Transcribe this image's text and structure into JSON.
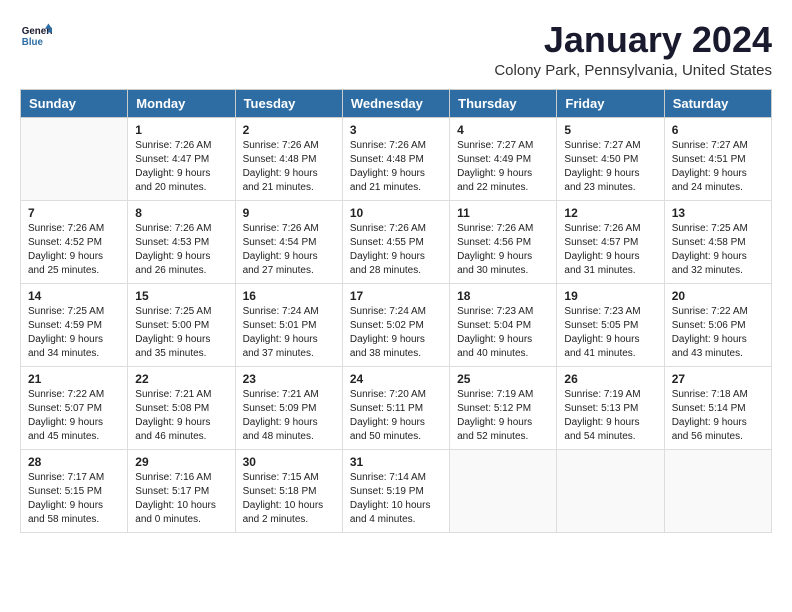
{
  "header": {
    "logo_line1": "General",
    "logo_line2": "Blue",
    "month": "January 2024",
    "location": "Colony Park, Pennsylvania, United States"
  },
  "days_of_week": [
    "Sunday",
    "Monday",
    "Tuesday",
    "Wednesday",
    "Thursday",
    "Friday",
    "Saturday"
  ],
  "weeks": [
    [
      {
        "day": "",
        "info": ""
      },
      {
        "day": "1",
        "info": "Sunrise: 7:26 AM\nSunset: 4:47 PM\nDaylight: 9 hours\nand 20 minutes."
      },
      {
        "day": "2",
        "info": "Sunrise: 7:26 AM\nSunset: 4:48 PM\nDaylight: 9 hours\nand 21 minutes."
      },
      {
        "day": "3",
        "info": "Sunrise: 7:26 AM\nSunset: 4:48 PM\nDaylight: 9 hours\nand 21 minutes."
      },
      {
        "day": "4",
        "info": "Sunrise: 7:27 AM\nSunset: 4:49 PM\nDaylight: 9 hours\nand 22 minutes."
      },
      {
        "day": "5",
        "info": "Sunrise: 7:27 AM\nSunset: 4:50 PM\nDaylight: 9 hours\nand 23 minutes."
      },
      {
        "day": "6",
        "info": "Sunrise: 7:27 AM\nSunset: 4:51 PM\nDaylight: 9 hours\nand 24 minutes."
      }
    ],
    [
      {
        "day": "7",
        "info": "Sunrise: 7:26 AM\nSunset: 4:52 PM\nDaylight: 9 hours\nand 25 minutes."
      },
      {
        "day": "8",
        "info": "Sunrise: 7:26 AM\nSunset: 4:53 PM\nDaylight: 9 hours\nand 26 minutes."
      },
      {
        "day": "9",
        "info": "Sunrise: 7:26 AM\nSunset: 4:54 PM\nDaylight: 9 hours\nand 27 minutes."
      },
      {
        "day": "10",
        "info": "Sunrise: 7:26 AM\nSunset: 4:55 PM\nDaylight: 9 hours\nand 28 minutes."
      },
      {
        "day": "11",
        "info": "Sunrise: 7:26 AM\nSunset: 4:56 PM\nDaylight: 9 hours\nand 30 minutes."
      },
      {
        "day": "12",
        "info": "Sunrise: 7:26 AM\nSunset: 4:57 PM\nDaylight: 9 hours\nand 31 minutes."
      },
      {
        "day": "13",
        "info": "Sunrise: 7:25 AM\nSunset: 4:58 PM\nDaylight: 9 hours\nand 32 minutes."
      }
    ],
    [
      {
        "day": "14",
        "info": "Sunrise: 7:25 AM\nSunset: 4:59 PM\nDaylight: 9 hours\nand 34 minutes."
      },
      {
        "day": "15",
        "info": "Sunrise: 7:25 AM\nSunset: 5:00 PM\nDaylight: 9 hours\nand 35 minutes."
      },
      {
        "day": "16",
        "info": "Sunrise: 7:24 AM\nSunset: 5:01 PM\nDaylight: 9 hours\nand 37 minutes."
      },
      {
        "day": "17",
        "info": "Sunrise: 7:24 AM\nSunset: 5:02 PM\nDaylight: 9 hours\nand 38 minutes."
      },
      {
        "day": "18",
        "info": "Sunrise: 7:23 AM\nSunset: 5:04 PM\nDaylight: 9 hours\nand 40 minutes."
      },
      {
        "day": "19",
        "info": "Sunrise: 7:23 AM\nSunset: 5:05 PM\nDaylight: 9 hours\nand 41 minutes."
      },
      {
        "day": "20",
        "info": "Sunrise: 7:22 AM\nSunset: 5:06 PM\nDaylight: 9 hours\nand 43 minutes."
      }
    ],
    [
      {
        "day": "21",
        "info": "Sunrise: 7:22 AM\nSunset: 5:07 PM\nDaylight: 9 hours\nand 45 minutes."
      },
      {
        "day": "22",
        "info": "Sunrise: 7:21 AM\nSunset: 5:08 PM\nDaylight: 9 hours\nand 46 minutes."
      },
      {
        "day": "23",
        "info": "Sunrise: 7:21 AM\nSunset: 5:09 PM\nDaylight: 9 hours\nand 48 minutes."
      },
      {
        "day": "24",
        "info": "Sunrise: 7:20 AM\nSunset: 5:11 PM\nDaylight: 9 hours\nand 50 minutes."
      },
      {
        "day": "25",
        "info": "Sunrise: 7:19 AM\nSunset: 5:12 PM\nDaylight: 9 hours\nand 52 minutes."
      },
      {
        "day": "26",
        "info": "Sunrise: 7:19 AM\nSunset: 5:13 PM\nDaylight: 9 hours\nand 54 minutes."
      },
      {
        "day": "27",
        "info": "Sunrise: 7:18 AM\nSunset: 5:14 PM\nDaylight: 9 hours\nand 56 minutes."
      }
    ],
    [
      {
        "day": "28",
        "info": "Sunrise: 7:17 AM\nSunset: 5:15 PM\nDaylight: 9 hours\nand 58 minutes."
      },
      {
        "day": "29",
        "info": "Sunrise: 7:16 AM\nSunset: 5:17 PM\nDaylight: 10 hours\nand 0 minutes."
      },
      {
        "day": "30",
        "info": "Sunrise: 7:15 AM\nSunset: 5:18 PM\nDaylight: 10 hours\nand 2 minutes."
      },
      {
        "day": "31",
        "info": "Sunrise: 7:14 AM\nSunset: 5:19 PM\nDaylight: 10 hours\nand 4 minutes."
      },
      {
        "day": "",
        "info": ""
      },
      {
        "day": "",
        "info": ""
      },
      {
        "day": "",
        "info": ""
      }
    ]
  ]
}
